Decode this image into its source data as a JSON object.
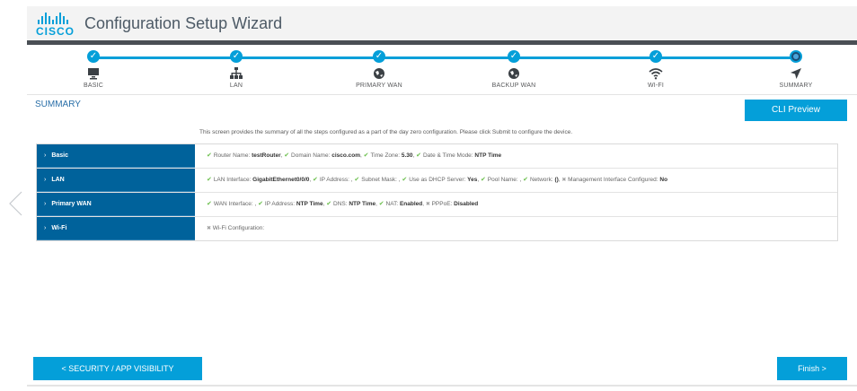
{
  "header": {
    "logo_text": "CISCO",
    "title": "Configuration Setup Wizard"
  },
  "steps": [
    {
      "label": "BASIC",
      "icon": "monitor-icon",
      "state": "done"
    },
    {
      "label": "LAN",
      "icon": "network-icon",
      "state": "done"
    },
    {
      "label": "PRIMARY WAN",
      "icon": "globe-icon",
      "state": "done"
    },
    {
      "label": "BACKUP WAN",
      "icon": "globe-icon",
      "state": "done"
    },
    {
      "label": "WI-FI",
      "icon": "wifi-icon",
      "state": "done"
    },
    {
      "label": "SUMMARY",
      "icon": "navigation-arrow-icon",
      "state": "current"
    }
  ],
  "summary": {
    "title": "SUMMARY",
    "cli_button": "CLI Preview",
    "intro": "This screen provides the summary of all the steps configured as a part of the day zero configuration. Please click Submit to configure the device.",
    "rows": [
      {
        "label": "Basic",
        "items": [
          {
            "status": "ok",
            "key": "Router Name: ",
            "value": "testRouter",
            "sep": ", "
          },
          {
            "status": "ok",
            "key": "Domain Name: ",
            "value": "cisco.com",
            "sep": ", "
          },
          {
            "status": "ok",
            "key": "Time Zone: ",
            "value": "5.30",
            "sep": ", "
          },
          {
            "status": "ok",
            "key": "Date & Time Mode: ",
            "value": "NTP Time",
            "sep": ""
          }
        ]
      },
      {
        "label": "LAN",
        "items": [
          {
            "status": "ok",
            "key": "LAN Interface: ",
            "value": "GigabitEthernet0/0/0",
            "sep": ", "
          },
          {
            "status": "ok",
            "key": "IP Address: ",
            "value": "",
            "sep": ", "
          },
          {
            "status": "ok",
            "key": "Subnet Mask: ",
            "value": "",
            "sep": ", "
          },
          {
            "status": "ok",
            "key": "Use as DHCP Server: ",
            "value": "Yes",
            "sep": ", "
          },
          {
            "status": "ok",
            "key": "Pool Name: ",
            "value": "",
            "sep": ", "
          },
          {
            "status": "ok",
            "key": "Network: ",
            "value": "()",
            "sep": ", "
          },
          {
            "status": "no",
            "key": "Management Interface Configured: ",
            "value": "No",
            "sep": ""
          }
        ]
      },
      {
        "label": "Primary WAN",
        "items": [
          {
            "status": "ok",
            "key": "WAN Interface: ",
            "value": "",
            "sep": ", "
          },
          {
            "status": "ok",
            "key": "IP Address: ",
            "value": "NTP Time",
            "sep": ", "
          },
          {
            "status": "ok",
            "key": "DNS: ",
            "value": "NTP Time",
            "sep": ", "
          },
          {
            "status": "ok",
            "key": "NAT: ",
            "value": "Enabled",
            "sep": ", "
          },
          {
            "status": "no",
            "key": "PPPoE: ",
            "value": "Disabled",
            "sep": ""
          }
        ]
      },
      {
        "label": "Wi-Fi",
        "items": [
          {
            "status": "no",
            "key": "Wi-Fi Configuration: ",
            "value": "",
            "sep": ""
          }
        ]
      }
    ]
  },
  "footer": {
    "prev_button": "< SECURITY / APP VISIBILITY",
    "finish_button": "Finish >"
  },
  "colors": {
    "accent": "#049fd9",
    "row_header": "#00629b",
    "check": "#6abf4b"
  }
}
